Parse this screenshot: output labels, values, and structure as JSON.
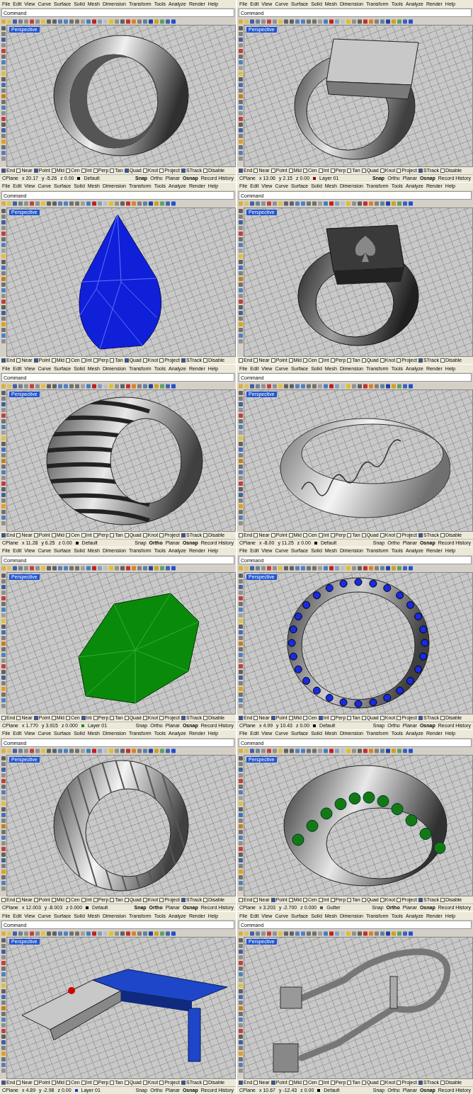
{
  "panels": [
    {
      "kind": "ring",
      "menu": [
        "File",
        "Edit",
        "View",
        "Curve",
        "Surface",
        "Solid",
        "Mesh",
        "Dimension",
        "Transform",
        "Tools",
        "Analyze",
        "Render",
        "Help"
      ],
      "command": "Command",
      "viewport": "Perspective",
      "osnaps": [
        {
          "label": "End",
          "checked": true
        },
        {
          "label": "Near",
          "checked": false
        },
        {
          "label": "Point",
          "checked": true
        },
        {
          "label": "Mid",
          "checked": false
        },
        {
          "label": "Cen",
          "checked": false
        },
        {
          "label": "Int",
          "checked": false
        },
        {
          "label": "Perp",
          "checked": false
        },
        {
          "label": "Tan",
          "checked": false
        },
        {
          "label": "Quad",
          "checked": true
        },
        {
          "label": "Knot",
          "checked": false
        },
        {
          "label": "Project",
          "checked": false
        },
        {
          "label": "STrack",
          "checked": true
        },
        {
          "label": "Disable",
          "checked": false
        }
      ],
      "status": {
        "cplane": "CPlane",
        "x": "x 20.17",
        "y": "y -5.26",
        "z": "z 0.00",
        "layer": "Default",
        "color": "#000000",
        "toggles": [
          {
            "label": "Snap",
            "on": true
          },
          {
            "label": "Ortho",
            "on": false
          },
          {
            "label": "Planar",
            "on": false
          },
          {
            "label": "Osnap",
            "on": true
          },
          {
            "label": "Record History",
            "on": false
          }
        ]
      }
    },
    {
      "kind": "signet-ring",
      "menu": [
        "File",
        "Edit",
        "View",
        "Curve",
        "Surface",
        "Solid",
        "Mesh",
        "Dimension",
        "Transform",
        "Tools",
        "Analyze",
        "Render",
        "Help"
      ],
      "command": "Command",
      "viewport": "Perspective",
      "osnaps": [
        {
          "label": "End",
          "checked": true
        },
        {
          "label": "Near",
          "checked": false
        },
        {
          "label": "Point",
          "checked": false
        },
        {
          "label": "Mid",
          "checked": false
        },
        {
          "label": "Cen",
          "checked": false
        },
        {
          "label": "Int",
          "checked": false
        },
        {
          "label": "Perp",
          "checked": false
        },
        {
          "label": "Tan",
          "checked": false
        },
        {
          "label": "Quad",
          "checked": false
        },
        {
          "label": "Knot",
          "checked": false
        },
        {
          "label": "Project",
          "checked": false
        },
        {
          "label": "STrack",
          "checked": true
        },
        {
          "label": "Disable",
          "checked": false
        }
      ],
      "status": {
        "cplane": "CPlane",
        "x": "x 13.06",
        "y": "y 2.15",
        "z": "z 0.00",
        "layer": "Layer 01",
        "color": "#8b0000",
        "toggles": [
          {
            "label": "Snap",
            "on": true
          },
          {
            "label": "Ortho",
            "on": false
          },
          {
            "label": "Planar",
            "on": false
          },
          {
            "label": "Osnap",
            "on": true
          },
          {
            "label": "Record History",
            "on": false
          }
        ]
      }
    },
    {
      "kind": "pear-gem",
      "menu": [
        "File",
        "Edit",
        "View",
        "Curve",
        "Surface",
        "Solid",
        "Mesh",
        "Dimension",
        "Transform",
        "Tools",
        "Analyze",
        "Render",
        "Help"
      ],
      "command": "Command",
      "viewport": "Perspective",
      "osnaps": [
        {
          "label": "End",
          "checked": true
        },
        {
          "label": "Near",
          "checked": false
        },
        {
          "label": "Point",
          "checked": true
        },
        {
          "label": "Mid",
          "checked": false
        },
        {
          "label": "Cen",
          "checked": false
        },
        {
          "label": "Int",
          "checked": false
        },
        {
          "label": "Perp",
          "checked": false
        },
        {
          "label": "Tan",
          "checked": false
        },
        {
          "label": "Quad",
          "checked": true
        },
        {
          "label": "Knot",
          "checked": false
        },
        {
          "label": "Project",
          "checked": false
        },
        {
          "label": "STrack",
          "checked": true
        },
        {
          "label": "Disable",
          "checked": false
        }
      ]
    },
    {
      "kind": "spade-ring",
      "menu": [
        "File",
        "Edit",
        "View",
        "Curve",
        "Surface",
        "Solid",
        "Mesh",
        "Dimension",
        "Transform",
        "Tools",
        "Analyze",
        "Render",
        "Help"
      ],
      "command": "Command",
      "viewport": "Perspective",
      "osnaps": [
        {
          "label": "End",
          "checked": false
        },
        {
          "label": "Near",
          "checked": false
        },
        {
          "label": "Point",
          "checked": false
        },
        {
          "label": "Mid",
          "checked": false
        },
        {
          "label": "Cen",
          "checked": false
        },
        {
          "label": "Int",
          "checked": false
        },
        {
          "label": "Perp",
          "checked": false
        },
        {
          "label": "Tan",
          "checked": false
        },
        {
          "label": "Quad",
          "checked": false
        },
        {
          "label": "Knot",
          "checked": false
        },
        {
          "label": "Project",
          "checked": false
        },
        {
          "label": "STrack",
          "checked": true
        },
        {
          "label": "Disable",
          "checked": false
        }
      ]
    },
    {
      "kind": "slotted-ring",
      "menu": [
        "File",
        "Edit",
        "View",
        "Curve",
        "Surface",
        "Solid",
        "Mesh",
        "Dimension",
        "Transform",
        "Tools",
        "Analyze",
        "Render",
        "Help"
      ],
      "command": "Command",
      "viewport": "Perspective",
      "osnaps": [
        {
          "label": "End",
          "checked": true
        },
        {
          "label": "Near",
          "checked": false
        },
        {
          "label": "Point",
          "checked": false
        },
        {
          "label": "Mid",
          "checked": false
        },
        {
          "label": "Cen",
          "checked": false
        },
        {
          "label": "Int",
          "checked": false
        },
        {
          "label": "Perp",
          "checked": false
        },
        {
          "label": "Tan",
          "checked": false
        },
        {
          "label": "Quad",
          "checked": false
        },
        {
          "label": "Knot",
          "checked": false
        },
        {
          "label": "Project",
          "checked": false
        },
        {
          "label": "STrack",
          "checked": true
        },
        {
          "label": "Disable",
          "checked": false
        }
      ],
      "status": {
        "cplane": "CPlane",
        "x": "x 11.28",
        "y": "y 6.25",
        "z": "z 0.00",
        "layer": "Default",
        "color": "#000000",
        "toggles": [
          {
            "label": "Snap",
            "on": false
          },
          {
            "label": "Ortho",
            "on": true
          },
          {
            "label": "Planar",
            "on": false
          },
          {
            "label": "Osnap",
            "on": true
          },
          {
            "label": "Record History",
            "on": false
          }
        ]
      }
    },
    {
      "kind": "engraved-ring",
      "menu": [
        "File",
        "Edit",
        "View",
        "Curve",
        "Surface",
        "Solid",
        "Mesh",
        "Dimension",
        "Transform",
        "Tools",
        "Analyze",
        "Render",
        "Help"
      ],
      "command": "Command",
      "viewport": "Perspective",
      "osnaps": [
        {
          "label": "End",
          "checked": false
        },
        {
          "label": "Near",
          "checked": false
        },
        {
          "label": "Point",
          "checked": false
        },
        {
          "label": "Mid",
          "checked": false
        },
        {
          "label": "Cen",
          "checked": false
        },
        {
          "label": "Int",
          "checked": false
        },
        {
          "label": "Perp",
          "checked": false
        },
        {
          "label": "Tan",
          "checked": false
        },
        {
          "label": "Quad",
          "checked": false
        },
        {
          "label": "Knot",
          "checked": false
        },
        {
          "label": "Project",
          "checked": false
        },
        {
          "label": "STrack",
          "checked": true
        },
        {
          "label": "Disable",
          "checked": false
        }
      ],
      "status": {
        "cplane": "CPlane",
        "x": "x -8.00",
        "y": "y 11.25",
        "z": "z 0.00",
        "layer": "Default",
        "color": "#000000",
        "toggles": [
          {
            "label": "Snap",
            "on": false
          },
          {
            "label": "Ortho",
            "on": false
          },
          {
            "label": "Planar",
            "on": false
          },
          {
            "label": "Osnap",
            "on": true
          },
          {
            "label": "Record History",
            "on": false
          }
        ]
      }
    },
    {
      "kind": "round-gem",
      "menu": [
        "File",
        "Edit",
        "View",
        "Curve",
        "Surface",
        "Solid",
        "Mesh",
        "Dimension",
        "Transform",
        "Tools",
        "Analyze",
        "Render",
        "Help"
      ],
      "command": "Command",
      "viewport": "Perspective",
      "osnaps": [
        {
          "label": "End",
          "checked": false
        },
        {
          "label": "Near",
          "checked": false
        },
        {
          "label": "Point",
          "checked": true
        },
        {
          "label": "Mid",
          "checked": false
        },
        {
          "label": "Cen",
          "checked": false
        },
        {
          "label": "Int",
          "checked": true
        },
        {
          "label": "Perp",
          "checked": false
        },
        {
          "label": "Tan",
          "checked": false
        },
        {
          "label": "Quad",
          "checked": false
        },
        {
          "label": "Knot",
          "checked": false
        },
        {
          "label": "Project",
          "checked": false
        },
        {
          "label": "STrack",
          "checked": true
        },
        {
          "label": "Disable",
          "checked": false
        }
      ],
      "status": {
        "cplane": "CPlane",
        "x": "x 1.770",
        "y": "y 3.915",
        "z": "z 0.000",
        "layer": "Layer 01",
        "color": "#1a8a1a",
        "toggles": [
          {
            "label": "Snap",
            "on": false
          },
          {
            "label": "Ortho",
            "on": false
          },
          {
            "label": "Planar",
            "on": false
          },
          {
            "label": "Osnap",
            "on": true
          },
          {
            "label": "Record History",
            "on": false
          }
        ]
      }
    },
    {
      "kind": "eternity-band",
      "menu": [
        "File",
        "Edit",
        "View",
        "Curve",
        "Surface",
        "Solid",
        "Mesh",
        "Dimension",
        "Transform",
        "Tools",
        "Analyze",
        "Render",
        "Help"
      ],
      "command": "Command",
      "viewport": "Perspective",
      "osnaps": [
        {
          "label": "End",
          "checked": true
        },
        {
          "label": "Near",
          "checked": false
        },
        {
          "label": "Point",
          "checked": true
        },
        {
          "label": "Mid",
          "checked": false
        },
        {
          "label": "Cen",
          "checked": false
        },
        {
          "label": "Int",
          "checked": true
        },
        {
          "label": "Perp",
          "checked": false
        },
        {
          "label": "Tan",
          "checked": false
        },
        {
          "label": "Quad",
          "checked": false
        },
        {
          "label": "Knot",
          "checked": false
        },
        {
          "label": "Project",
          "checked": false
        },
        {
          "label": "STrack",
          "checked": true
        },
        {
          "label": "Disable",
          "checked": false
        }
      ],
      "status": {
        "cplane": "CPlane",
        "x": "x 4.99",
        "y": "y 10.43",
        "z": "z 0.00",
        "layer": "Default",
        "color": "#000000",
        "toggles": [
          {
            "label": "Snap",
            "on": false
          },
          {
            "label": "Ortho",
            "on": false
          },
          {
            "label": "Planar",
            "on": false
          },
          {
            "label": "Osnap",
            "on": true
          },
          {
            "label": "Record History",
            "on": false
          }
        ]
      }
    },
    {
      "kind": "twisted-ring",
      "menu": [
        "File",
        "Edit",
        "View",
        "Curve",
        "Surface",
        "Solid",
        "Mesh",
        "Dimension",
        "Transform",
        "Tools",
        "Analyze",
        "Render",
        "Help"
      ],
      "command": "Command",
      "viewport": "Perspective",
      "osnaps": [
        {
          "label": "End",
          "checked": false
        },
        {
          "label": "Near",
          "checked": false
        },
        {
          "label": "Point",
          "checked": false
        },
        {
          "label": "Mid",
          "checked": false
        },
        {
          "label": "Cen",
          "checked": false
        },
        {
          "label": "Int",
          "checked": false
        },
        {
          "label": "Perp",
          "checked": false
        },
        {
          "label": "Tan",
          "checked": false
        },
        {
          "label": "Quad",
          "checked": false
        },
        {
          "label": "Knot",
          "checked": false
        },
        {
          "label": "Project",
          "checked": false
        },
        {
          "label": "STrack",
          "checked": true
        },
        {
          "label": "Disable",
          "checked": false
        }
      ],
      "status": {
        "cplane": "CPlane",
        "x": "x 12.003",
        "y": "y -8.003",
        "z": "z 0.000",
        "layer": "Default",
        "color": "#000000",
        "toggles": [
          {
            "label": "Snap",
            "on": true
          },
          {
            "label": "Ortho",
            "on": true
          },
          {
            "label": "Planar",
            "on": false
          },
          {
            "label": "Osnap",
            "on": true
          },
          {
            "label": "Record History",
            "on": false
          }
        ]
      }
    },
    {
      "kind": "stone-ring",
      "menu": [
        "File",
        "Edit",
        "View",
        "Curve",
        "Surface",
        "Solid",
        "Mesh",
        "Dimension",
        "Transform",
        "Tools",
        "Analyze",
        "Render",
        "Help"
      ],
      "command": "Command",
      "viewport": "Perspective",
      "osnaps": [
        {
          "label": "End",
          "checked": false
        },
        {
          "label": "Near",
          "checked": false
        },
        {
          "label": "Point",
          "checked": true
        },
        {
          "label": "Mid",
          "checked": false
        },
        {
          "label": "Cen",
          "checked": false
        },
        {
          "label": "Int",
          "checked": false
        },
        {
          "label": "Perp",
          "checked": false
        },
        {
          "label": "Tan",
          "checked": false
        },
        {
          "label": "Quad",
          "checked": false
        },
        {
          "label": "Knot",
          "checked": false
        },
        {
          "label": "Project",
          "checked": false
        },
        {
          "label": "STrack",
          "checked": true
        },
        {
          "label": "Disable",
          "checked": false
        }
      ],
      "status": {
        "cplane": "CPlane",
        "x": "x 3.203",
        "y": "y -2.700",
        "z": "z 0.000",
        "layer": "Gutter",
        "color": "#555555",
        "toggles": [
          {
            "label": "Snap",
            "on": false
          },
          {
            "label": "Ortho",
            "on": true
          },
          {
            "label": "Planar",
            "on": false
          },
          {
            "label": "Osnap",
            "on": true
          },
          {
            "label": "Record History",
            "on": false
          }
        ]
      }
    },
    {
      "kind": "bar",
      "menu": [
        "File",
        "Edit",
        "View",
        "Curve",
        "Surface",
        "Solid",
        "Mesh",
        "Dimension",
        "Transform",
        "Tools",
        "Analyze",
        "Render",
        "Help"
      ],
      "command": "Command",
      "viewport": "Perspective",
      "osnaps": [
        {
          "label": "End",
          "checked": true
        },
        {
          "label": "Near",
          "checked": false
        },
        {
          "label": "Point",
          "checked": false
        },
        {
          "label": "Mid",
          "checked": false
        },
        {
          "label": "Cen",
          "checked": false
        },
        {
          "label": "Int",
          "checked": false
        },
        {
          "label": "Perp",
          "checked": false
        },
        {
          "label": "Tan",
          "checked": false
        },
        {
          "label": "Quad",
          "checked": false
        },
        {
          "label": "Knot",
          "checked": false
        },
        {
          "label": "Project",
          "checked": false
        },
        {
          "label": "STrack",
          "checked": true
        },
        {
          "label": "Disable",
          "checked": false
        }
      ],
      "status": {
        "cplane": "CPlane",
        "x": "x 4.89",
        "y": "y -2.98",
        "z": "z 0.00",
        "layer": "Layer 01",
        "color": "#1a3acc",
        "toggles": [
          {
            "label": "Snap",
            "on": false
          },
          {
            "label": "Ortho",
            "on": false
          },
          {
            "label": "Planar",
            "on": false
          },
          {
            "label": "Osnap",
            "on": true
          },
          {
            "label": "Record History",
            "on": false
          }
        ]
      }
    },
    {
      "kind": "wire",
      "menu": [
        "File",
        "Edit",
        "View",
        "Curve",
        "Surface",
        "Solid",
        "Mesh",
        "Dimension",
        "Transform",
        "Tools",
        "Analyze",
        "Render",
        "Help"
      ],
      "command": "Command",
      "viewport": "Perspective",
      "osnaps": [
        {
          "label": "End",
          "checked": true
        },
        {
          "label": "Near",
          "checked": false
        },
        {
          "label": "Point",
          "checked": true
        },
        {
          "label": "Mid",
          "checked": false
        },
        {
          "label": "Cen",
          "checked": false
        },
        {
          "label": "Int",
          "checked": false
        },
        {
          "label": "Perp",
          "checked": false
        },
        {
          "label": "Tan",
          "checked": false
        },
        {
          "label": "Quad",
          "checked": false
        },
        {
          "label": "Knot",
          "checked": false
        },
        {
          "label": "Project",
          "checked": false
        },
        {
          "label": "STrack",
          "checked": true
        },
        {
          "label": "Disable",
          "checked": false
        }
      ],
      "status": {
        "cplane": "CPlane",
        "x": "x 10.67",
        "y": "y -12.43",
        "z": "z 0.00",
        "layer": "Default",
        "color": "#000000",
        "toggles": [
          {
            "label": "Snap",
            "on": false
          },
          {
            "label": "Ortho",
            "on": false
          },
          {
            "label": "Planar",
            "on": false
          },
          {
            "label": "Osnap",
            "on": true
          },
          {
            "label": "Record History",
            "on": false
          }
        ]
      }
    }
  ]
}
